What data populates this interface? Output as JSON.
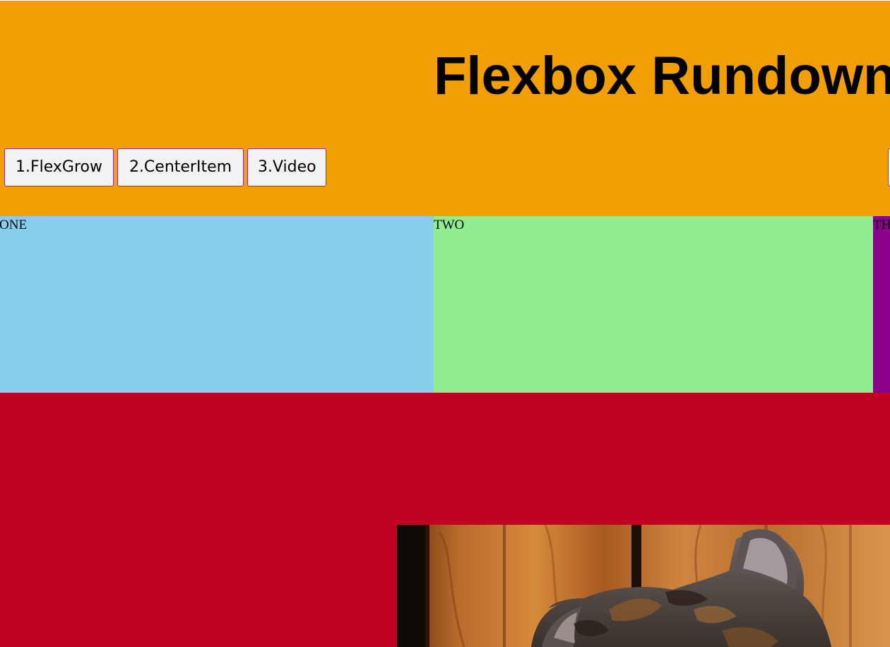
{
  "header": {
    "title": "Flexbox Rundown",
    "background_color": "#f29e05",
    "nav_buttons": [
      {
        "label": "1.FlexGrow"
      },
      {
        "label": "2.CenterItem"
      },
      {
        "label": "3.Video"
      },
      {
        "label": ""
      }
    ]
  },
  "flex_row": {
    "items": [
      {
        "label": "ONE",
        "color": "#87ceeb"
      },
      {
        "label": "TWO",
        "color": "#90ee90"
      },
      {
        "label": "TH",
        "color": "#8b008b"
      }
    ]
  },
  "section": {
    "background_color": "#c00323",
    "image": {
      "subject": "kitten",
      "icon": "kitten-photo"
    }
  }
}
